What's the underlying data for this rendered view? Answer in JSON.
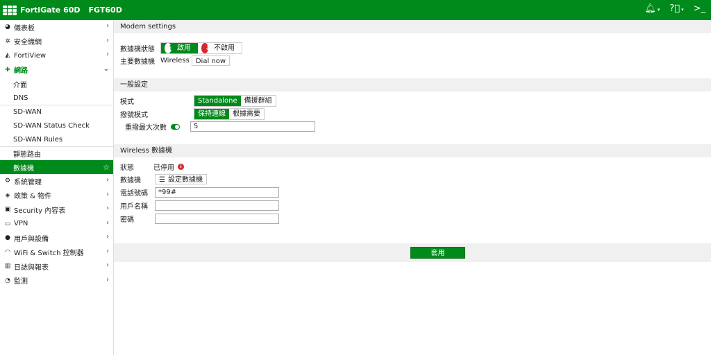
{
  "topbar": {
    "brand": "FortiGate 60D",
    "hostname": "FGT60D"
  },
  "sidebar": {
    "items": [
      {
        "label": "儀表板",
        "icon": "dashboard-icon"
      },
      {
        "label": "安全織網",
        "icon": "fabric-icon"
      },
      {
        "label": "FortiView",
        "icon": "chart-icon"
      },
      {
        "label": "網路",
        "icon": "network-icon"
      }
    ],
    "sub_items": [
      "介面",
      "DNS",
      "SD-WAN",
      "SD-WAN Status Check",
      "SD-WAN Rules",
      "靜態路由",
      "數據機"
    ],
    "items2": [
      {
        "label": "系統管理",
        "icon": "gear-icon"
      },
      {
        "label": "政策 & 物件",
        "icon": "shield-icon"
      },
      {
        "label": "Security 內容表",
        "icon": "lock-icon"
      },
      {
        "label": "VPN",
        "icon": "monitor-icon"
      },
      {
        "label": "用戶與設備",
        "icon": "user-icon"
      },
      {
        "label": "WiFi & Switch 控制器",
        "icon": "wifi-icon"
      },
      {
        "label": "日誌與報表",
        "icon": "bar-chart-icon"
      },
      {
        "label": "監測",
        "icon": "pie-icon"
      }
    ]
  },
  "modem": {
    "section": "Modem settings",
    "status_label": "數據機狀態",
    "enable": "啟用",
    "disable": "不啟用",
    "primary_label": "主要數據機",
    "primary_value": "Wireless",
    "dial_now": "Dial now"
  },
  "general": {
    "section": "一般設定",
    "mode_label": "模式",
    "mode_standalone": "Standalone",
    "mode_redundant": "備援群組",
    "dial_label": "撥號模式",
    "dial_always": "保持連線",
    "dial_demand": "根據需要",
    "retry_label": "重撥最大次數",
    "retry_value": "5"
  },
  "wireless": {
    "section": "Wireless 數據機",
    "status_label": "狀態",
    "status_value": "已停用",
    "modem_label": "數據機",
    "configure": "設定數據機",
    "phone_label": "電話號碼",
    "phone_value": "*99#",
    "user_label": "用戶名稱",
    "pass_label": "密碼"
  },
  "apply_label": "套用",
  "colors": {
    "accent": "#008a1b",
    "disabled_red": "#d9262e"
  }
}
